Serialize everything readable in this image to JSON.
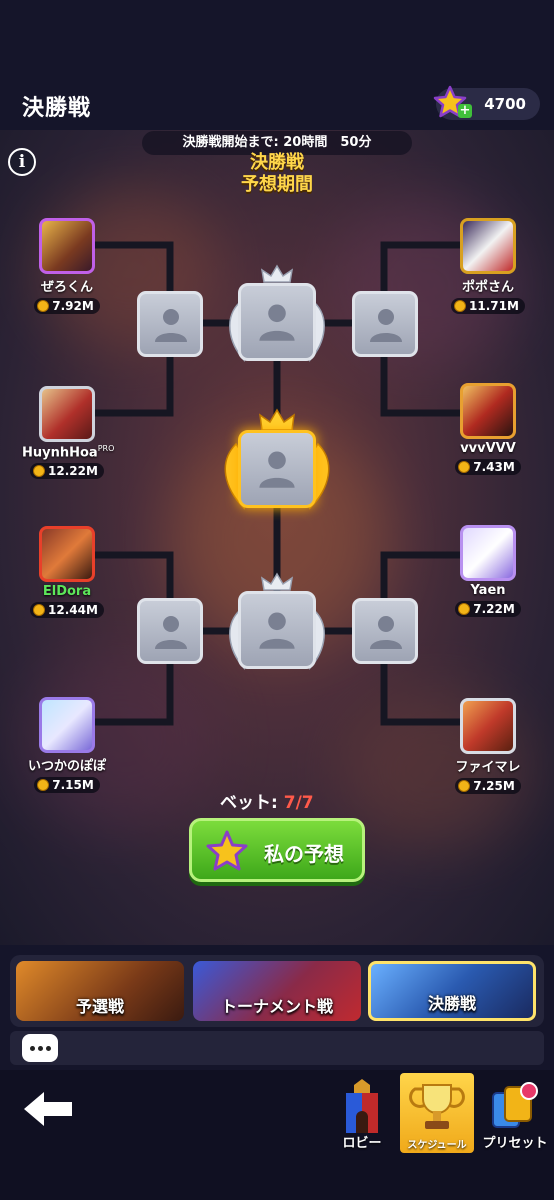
{
  "header": {
    "title": "決勝戦",
    "currency_amount": "4700"
  },
  "event": {
    "countdown": "決勝戦開始まで: 20時間　50分",
    "stage_title_line1": "決勝戦",
    "stage_title_line2": "予想期間"
  },
  "players": [
    {
      "name": "ぜろくん",
      "score": "7.92M",
      "side": "left"
    },
    {
      "name": "HuynhHoa",
      "name_suffix": "PRO",
      "score": "12.22M",
      "side": "left"
    },
    {
      "name": "ElDora",
      "score": "12.44M",
      "side": "left",
      "name_color": "#5de65a"
    },
    {
      "name": "いつかのぽぽ",
      "score": "7.15M",
      "side": "left"
    },
    {
      "name": "ポポさん",
      "score": "11.71M",
      "side": "right"
    },
    {
      "name": "vvvVVV",
      "score": "7.43M",
      "side": "right"
    },
    {
      "name": "Yaen",
      "score": "7.22M",
      "side": "right"
    },
    {
      "name": "ファイマレ",
      "score": "7.25M",
      "side": "right"
    }
  ],
  "bet": {
    "label": "ベット:",
    "value": "7/7"
  },
  "predict_button": "私の予想",
  "tabs": [
    {
      "label": "予選戦"
    },
    {
      "label": "トーナメント戦"
    },
    {
      "label": "決勝戦",
      "active": true
    }
  ],
  "nav": [
    {
      "label": "ロビー",
      "icon": "castle-icon"
    },
    {
      "label": "スケジュール",
      "icon": "trophy-icon",
      "active": true
    },
    {
      "label": "プリセット",
      "icon": "preset-icon"
    }
  ],
  "colors": {
    "accent_gold": "#ffd74a",
    "bet_value": "#ff5a4a",
    "button_green": "#4fbf24",
    "active_tab_border": "#ffe36a"
  }
}
